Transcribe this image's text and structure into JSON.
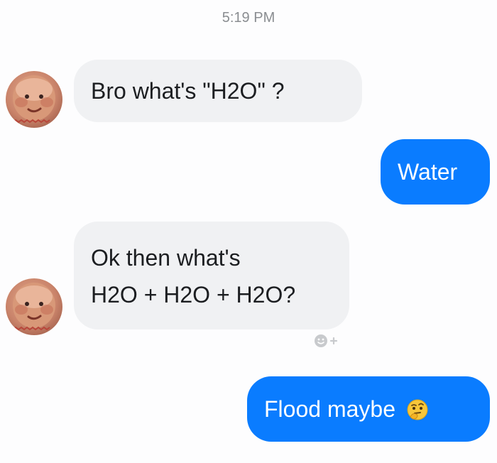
{
  "timestamp": "5:19 PM",
  "messages": [
    {
      "sender": "them",
      "lines": [
        "Bro what's \"H2O\" ?"
      ]
    },
    {
      "sender": "me",
      "lines": [
        "Water"
      ]
    },
    {
      "sender": "them",
      "lines": [
        "Ok then what's",
        "H2O + H2O + H2O?"
      ]
    },
    {
      "sender": "me",
      "lines": [
        "Flood maybe"
      ],
      "emoji": "🤔"
    }
  ],
  "colors": {
    "outgoing_bubble": "#0a7cff",
    "incoming_bubble": "#f0f1f3",
    "timestamp_text": "#8a8d91"
  },
  "icons": {
    "avatar": "baby-face-avatar",
    "reaction": "add-reaction-icon",
    "emoji": "thinking-face-emoji"
  }
}
